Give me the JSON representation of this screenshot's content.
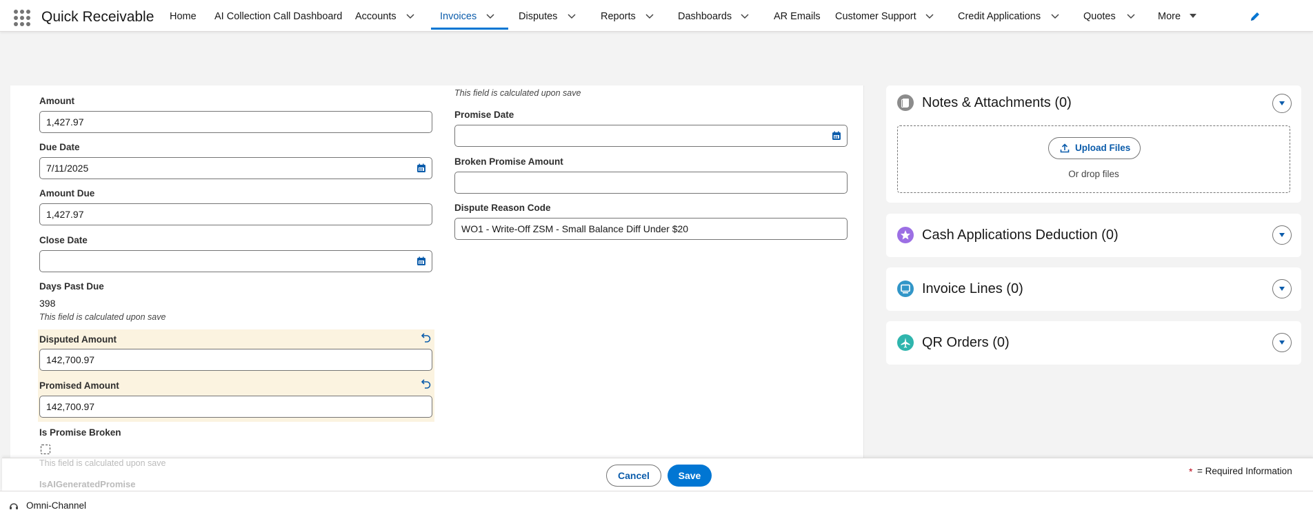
{
  "app": {
    "name": "Quick Receivable"
  },
  "nav": {
    "items": [
      {
        "label": "Home"
      },
      {
        "label": "AI Collection Call Dashboard"
      },
      {
        "label": "Accounts"
      },
      {
        "label": "Invoices"
      },
      {
        "label": "Disputes"
      },
      {
        "label": "Reports"
      },
      {
        "label": "Dashboards"
      },
      {
        "label": "AR Emails"
      },
      {
        "label": "Customer Support"
      },
      {
        "label": "Credit Applications"
      },
      {
        "label": "Quotes"
      },
      {
        "label": "More"
      }
    ],
    "active": "Invoices"
  },
  "form": {
    "left": {
      "amount": {
        "label": "Amount",
        "value": "1,427.97"
      },
      "due_date": {
        "label": "Due Date",
        "value": "7/11/2025"
      },
      "amount_due": {
        "label": "Amount Due",
        "value": "1,427.97"
      },
      "close_date": {
        "label": "Close Date",
        "value": ""
      },
      "days_past_due": {
        "label": "Days Past Due",
        "value": "398",
        "hint": "This field is calculated upon save"
      },
      "disputed_amount": {
        "label": "Disputed Amount",
        "value": "142,700.97"
      },
      "promised_amount": {
        "label": "Promised Amount",
        "value": "142,700.97"
      },
      "is_promise_broken": {
        "label": "Is Promise Broken",
        "hint": "This field is calculated upon save"
      },
      "is_ai_generated_promise": {
        "label": "IsAIGeneratedPromise"
      }
    },
    "right": {
      "top_hint": "This field is calculated upon save",
      "promise_date": {
        "label": "Promise Date",
        "value": ""
      },
      "broken_promise_amount": {
        "label": "Broken Promise Amount",
        "value": ""
      },
      "dispute_reason_code": {
        "label": "Dispute Reason Code",
        "value": "WO1 - Write-Off ZSM - Small Balance Diff Under $20"
      }
    }
  },
  "related": {
    "notes": {
      "title": "Notes & Attachments (0)",
      "upload_label": "Upload Files",
      "drop_text": "Or drop files"
    },
    "cash_apps": {
      "title": "Cash Applications Deduction (0)"
    },
    "invoice_lines": {
      "title": "Invoice Lines (0)"
    },
    "qr_orders": {
      "title": "QR Orders (0)"
    }
  },
  "footer": {
    "cancel_label": "Cancel",
    "save_label": "Save",
    "required_star": "*",
    "required_text": "= Required Information"
  },
  "utility": {
    "omni_label": "Omni-Channel"
  },
  "colors": {
    "brand_blue": "#0176d3",
    "link_blue": "#0b5cab",
    "changed_bg": "#fbf3e0",
    "required_red": "#ba0517"
  },
  "icons": {
    "waffle": "app-launcher-icon",
    "chevron": "chevron-down-icon",
    "edit": "pencil-icon",
    "calendar": "calendar-icon",
    "undo": "undo-icon",
    "upload": "upload-icon",
    "notes": "notes-icon",
    "cash": "star-icon",
    "lines": "monitor-icon",
    "qr": "plane-icon",
    "omni": "headset-icon"
  }
}
